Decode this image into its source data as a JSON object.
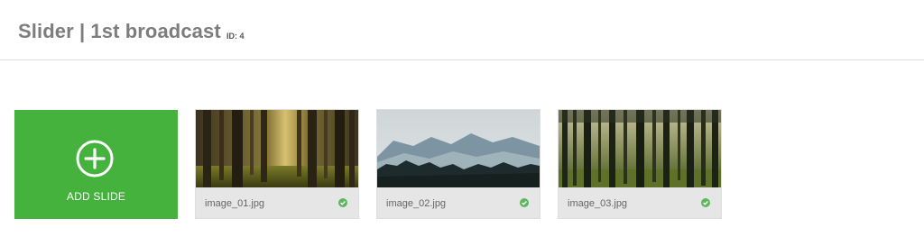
{
  "header": {
    "title": "Slider | 1st broadcast",
    "id_label": "ID: 4"
  },
  "add_slide": {
    "label": "ADD SLIDE",
    "icon": "plus-circle-icon",
    "color": "#45b23e"
  },
  "slides": [
    {
      "filename": "image_01.jpg",
      "status_icon": "check-circle-icon",
      "status_color": "#5cb85c"
    },
    {
      "filename": "image_02.jpg",
      "status_icon": "check-circle-icon",
      "status_color": "#5cb85c"
    },
    {
      "filename": "image_03.jpg",
      "status_icon": "check-circle-icon",
      "status_color": "#5cb85c"
    }
  ]
}
